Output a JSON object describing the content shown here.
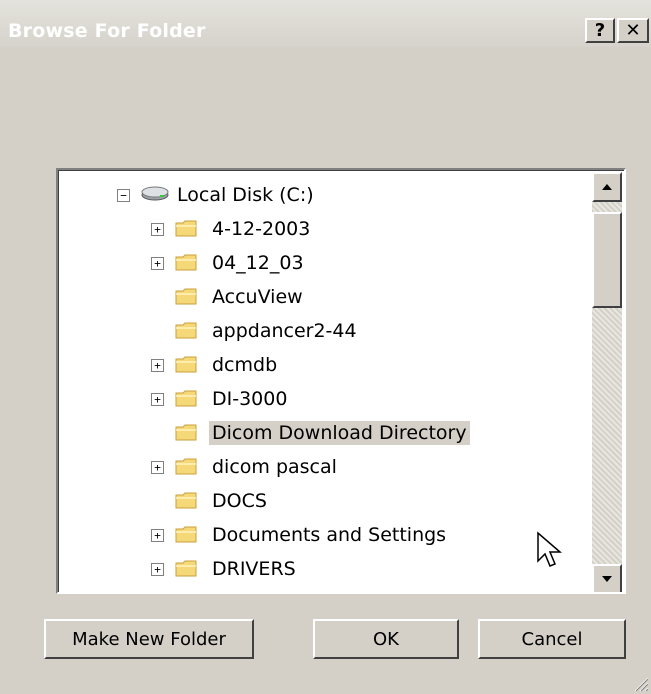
{
  "window": {
    "title": "Browse For Folder",
    "help_glyph": "?",
    "close_glyph": "✕"
  },
  "tree": {
    "root": {
      "label": "Local Disk (C:)",
      "expander": "−",
      "icon": "drive-icon"
    },
    "items": [
      {
        "label": "4-12-2003",
        "expander": "+",
        "selected": false
      },
      {
        "label": "04_12_03",
        "expander": "+",
        "selected": false
      },
      {
        "label": "AccuView",
        "expander": "",
        "selected": false
      },
      {
        "label": "appdancer2-44",
        "expander": "",
        "selected": false
      },
      {
        "label": "dcmdb",
        "expander": "+",
        "selected": false
      },
      {
        "label": "DI-3000",
        "expander": "+",
        "selected": false
      },
      {
        "label": "Dicom Download Directory",
        "expander": "",
        "selected": true
      },
      {
        "label": "dicom pascal",
        "expander": "+",
        "selected": false
      },
      {
        "label": "DOCS",
        "expander": "",
        "selected": false
      },
      {
        "label": "Documents and Settings",
        "expander": "+",
        "selected": false
      },
      {
        "label": "DRIVERS",
        "expander": "+",
        "selected": false
      }
    ]
  },
  "buttons": {
    "make_new_folder": "Make New Folder",
    "ok": "OK",
    "cancel": "Cancel"
  },
  "colors": {
    "face": "#d4d0c8",
    "folder": "#f5d878",
    "folder_edge": "#c9a13a"
  }
}
